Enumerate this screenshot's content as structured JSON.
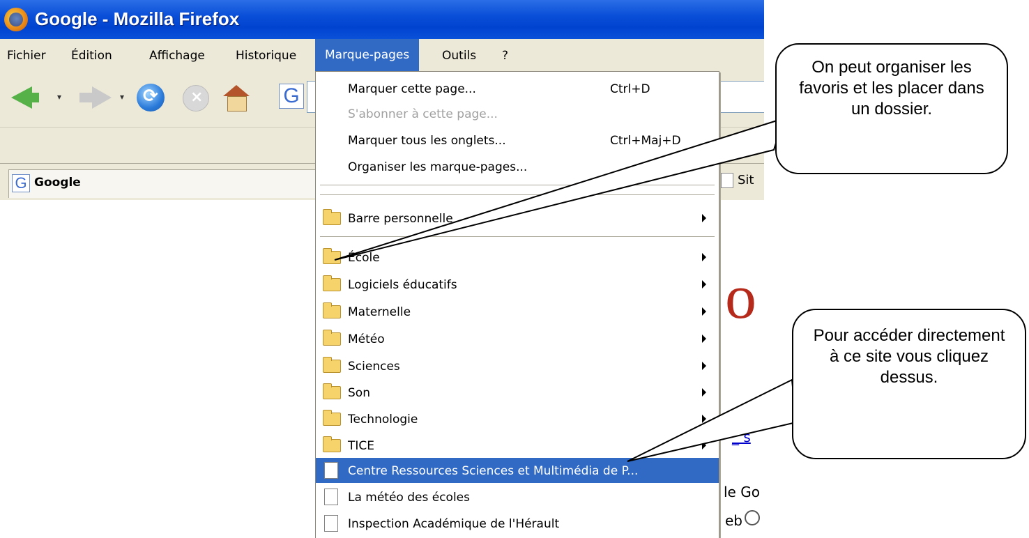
{
  "window": {
    "title": "Google - Mozilla Firefox"
  },
  "menubar": {
    "items": [
      "Fichier",
      "Édition",
      "Affichage",
      "Historique",
      "Marque-pages",
      "Outils",
      "?"
    ],
    "open": "Marque-pages"
  },
  "tab": {
    "label": "Google"
  },
  "partial_labels": {
    "sit": "Sit",
    "o_letter": "o",
    "ge_go": "le Go",
    "eb": "eb"
  },
  "dropdown": {
    "commands": [
      {
        "label": "Marquer cette page...",
        "shortcut": "Ctrl+D",
        "enabled": true
      },
      {
        "label": "S'abonner à cette page...",
        "shortcut": "",
        "enabled": false
      },
      {
        "label": "Marquer tous les onglets...",
        "shortcut": "Ctrl+Maj+D",
        "enabled": true
      },
      {
        "label": "Organiser les marque-pages...",
        "shortcut": "",
        "enabled": true
      }
    ],
    "folders": [
      "Barre personnelle",
      "École",
      "Logiciels éducatifs",
      "Maternelle",
      "Météo",
      "Sciences",
      "Son",
      "Technologie",
      "TICE"
    ],
    "bookmarks": [
      {
        "label": "Centre Ressources Sciences et Multimédia de P...",
        "highlighted": true
      },
      {
        "label": "La météo des écoles",
        "highlighted": false
      },
      {
        "label": "Inspection Académique de l'Hérault",
        "highlighted": false
      }
    ]
  },
  "callouts": {
    "top": "On peut organiser les favoris et les placer dans un dossier.",
    "bottom": "Pour accéder directement à ce site vous cliquez dessus."
  },
  "colors": {
    "titlebar": "#0a4fd8",
    "menu_bg": "#ece9d8",
    "highlight": "#316ac5"
  }
}
